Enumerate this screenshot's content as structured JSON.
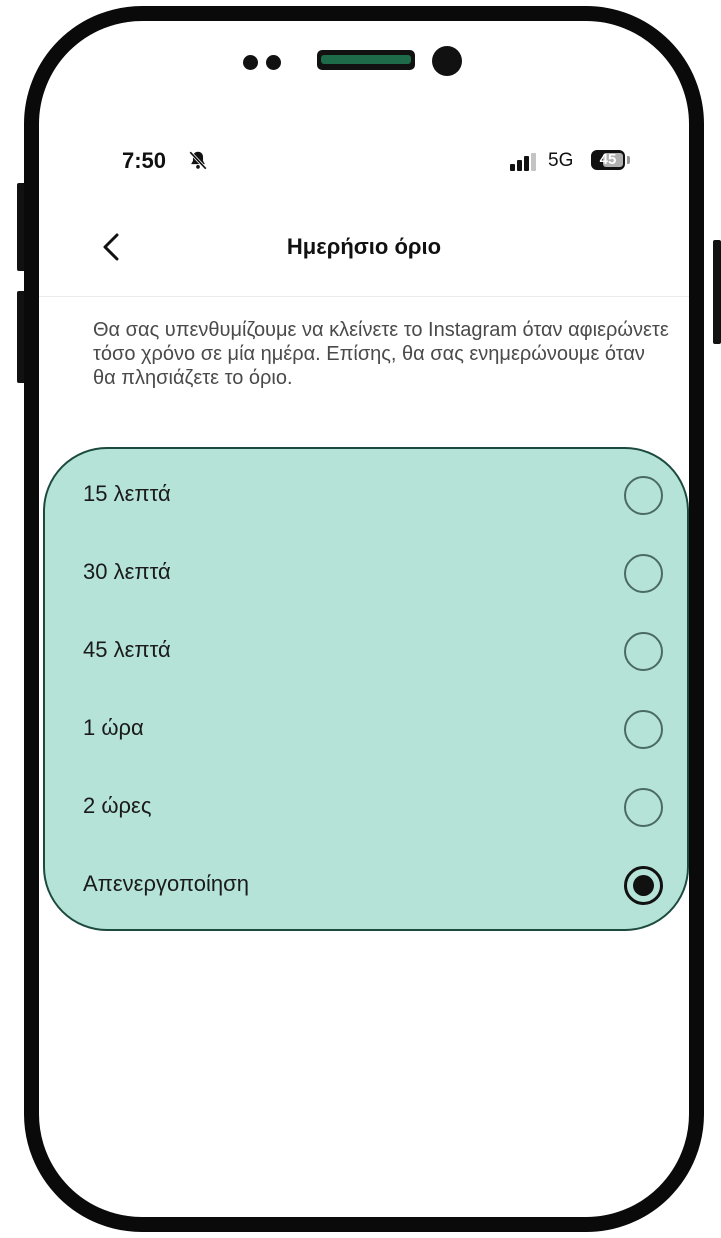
{
  "status_bar": {
    "time": "7:50",
    "network": "5G",
    "battery": "45",
    "icons": [
      "bell-muted-icon",
      "signal-icon"
    ]
  },
  "header": {
    "title": "Ημερήσιο όριο",
    "back_icon": "chevron-left-icon"
  },
  "description": "Θα σας υπενθυμίζουμε να κλείνετε το Instagram όταν αφιερώνετε τόσο χρόνο σε μία ημέρα. Επίσης, θα σας ενημερώνουμε όταν θα πλησιάζετε το όριο.",
  "options": [
    {
      "label": "15 λεπτά",
      "selected": false
    },
    {
      "label": "30 λεπτά",
      "selected": false
    },
    {
      "label": "45 λεπτά",
      "selected": false
    },
    {
      "label": "1 ώρα",
      "selected": false
    },
    {
      "label": "2 ώρες",
      "selected": false
    },
    {
      "label": "Απενεργοποίηση",
      "selected": true
    }
  ],
  "colors": {
    "highlight_panel": "#b5e3d8",
    "panel_border": "#1d4a3e"
  }
}
